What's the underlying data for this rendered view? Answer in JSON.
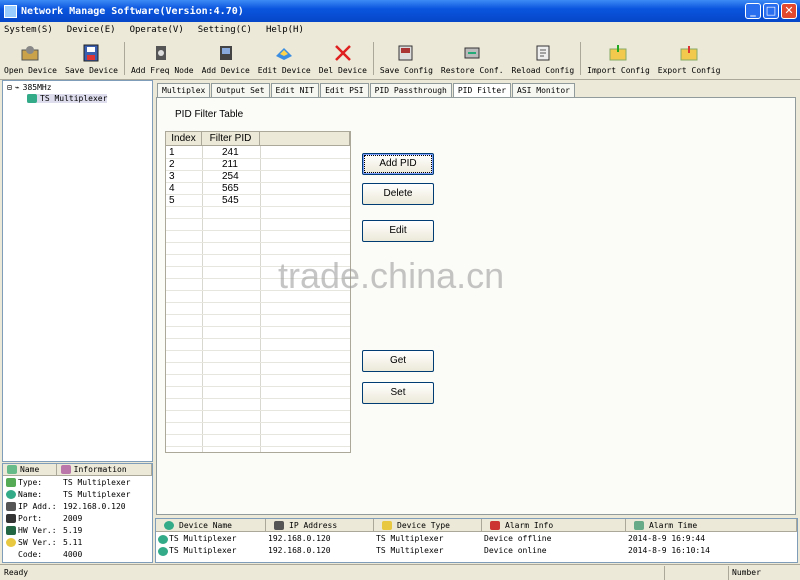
{
  "window": {
    "title": "Network Manage Software(Version:4.70)",
    "minimize": "_",
    "maximize": "□",
    "close": "✕"
  },
  "menu": [
    "System(S)",
    "Device(E)",
    "Operate(V)",
    "Setting(C)",
    "Help(H)"
  ],
  "toolbar": [
    {
      "label": "Open Device",
      "icon": "open-device-icon"
    },
    {
      "label": "Save Device",
      "icon": "save-device-icon"
    },
    {
      "label": "Add Freq Node",
      "icon": "add-freq-node-icon"
    },
    {
      "label": "Add Device",
      "icon": "add-device-icon"
    },
    {
      "label": "Edit Device",
      "icon": "edit-device-icon"
    },
    {
      "label": "Del Device",
      "icon": "delete-icon"
    },
    {
      "label": "Save Config",
      "icon": "save-config-icon"
    },
    {
      "label": "Restore Conf.",
      "icon": "restore-config-icon"
    },
    {
      "label": "Reload Config",
      "icon": "reload-config-icon"
    },
    {
      "label": "Import Config",
      "icon": "import-config-icon"
    },
    {
      "label": "Export Config",
      "icon": "export-config-icon"
    }
  ],
  "tree": {
    "root": "385MHz",
    "child": "TS Multiplexer"
  },
  "info": {
    "headers": [
      "Name",
      "Information"
    ],
    "rows": [
      {
        "k": "Type:",
        "v": "TS Multiplexer"
      },
      {
        "k": "Name:",
        "v": "TS Multiplexer"
      },
      {
        "k": "IP Add.:",
        "v": "192.168.0.120"
      },
      {
        "k": "Port:",
        "v": "2009"
      },
      {
        "k": "HW Ver.:",
        "v": "5.19"
      },
      {
        "k": "SW Ver.:",
        "v": "5.11"
      },
      {
        "k": "Code:",
        "v": "4000"
      }
    ]
  },
  "tabs": [
    "Multiplex",
    "Output Set",
    "Edit NIT",
    "Edit PSI",
    "PID Passthrough",
    "PID Filter",
    "ASI Monitor"
  ],
  "active_tab": "PID Filter",
  "panel": {
    "title": "PID Filter Table",
    "columns": [
      "Index",
      "Filter PID"
    ],
    "rows": [
      {
        "index": "1",
        "pid": "241"
      },
      {
        "index": "2",
        "pid": "211"
      },
      {
        "index": "3",
        "pid": "254"
      },
      {
        "index": "4",
        "pid": "565"
      },
      {
        "index": "5",
        "pid": "545"
      }
    ],
    "buttons": {
      "add": "Add PID",
      "delete": "Delete",
      "edit": "Edit",
      "get": "Get",
      "set": "Set"
    }
  },
  "watermark": "trade.china.cn",
  "alarm": {
    "headers": [
      "Device Name",
      "IP Address",
      "Device Type",
      "Alarm Info",
      "Alarm Time"
    ],
    "rows": [
      [
        "TS Multiplexer",
        "192.168.0.120",
        "TS Multiplexer",
        "Device offline",
        "2014-8-9 16:9:44"
      ],
      [
        "TS Multiplexer",
        "192.168.0.120",
        "TS Multiplexer",
        "Device online",
        "2014-8-9 16:10:14"
      ]
    ]
  },
  "status": {
    "left": "Ready",
    "right": "Number"
  }
}
